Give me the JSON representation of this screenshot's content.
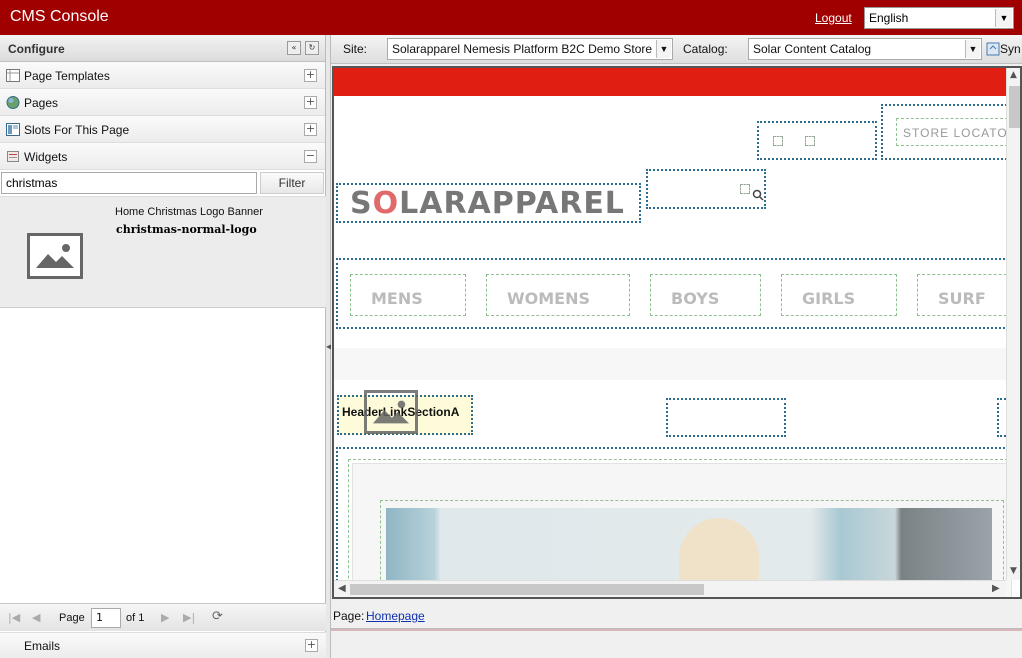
{
  "header": {
    "app_title": "CMS Console",
    "logout_label": "Logout",
    "language": "English"
  },
  "left_panel": {
    "title": "Configure",
    "sections": [
      {
        "label": "Page Templates",
        "toggle": "+"
      },
      {
        "label": "Pages",
        "toggle": "+"
      },
      {
        "label": "Slots For This Page",
        "toggle": "+"
      },
      {
        "label": "Widgets",
        "toggle": "−"
      }
    ],
    "search": {
      "value": "christmas",
      "filter_label": "Filter"
    },
    "widget_result": {
      "name": "Home Christmas Logo Banner",
      "id": "christmas-normal-logo"
    },
    "pager": {
      "page_label": "Page",
      "page_value": "1",
      "of_label": "of 1"
    },
    "emails_label": "Emails",
    "emails_toggle": "+"
  },
  "site_bar": {
    "site_label": "Site:",
    "site_value": "Solarapparel Nemesis Platform B2C Demo Store",
    "catalog_label": "Catalog:",
    "catalog_value": "Solar Content Catalog",
    "sync_label": "Syn"
  },
  "preview": {
    "logo_prefix": "S",
    "logo_o": "O",
    "logo_rest": "LARAPPAREL",
    "store_locator": "STORE LOCATOR",
    "nav": [
      "MENS",
      "WOMENS",
      "BOYS",
      "GIRLS",
      "SURF"
    ],
    "header_link_section": "HeaderLinkSectionA"
  },
  "footer": {
    "page_label": "Page:",
    "page_link": "Homepage"
  }
}
